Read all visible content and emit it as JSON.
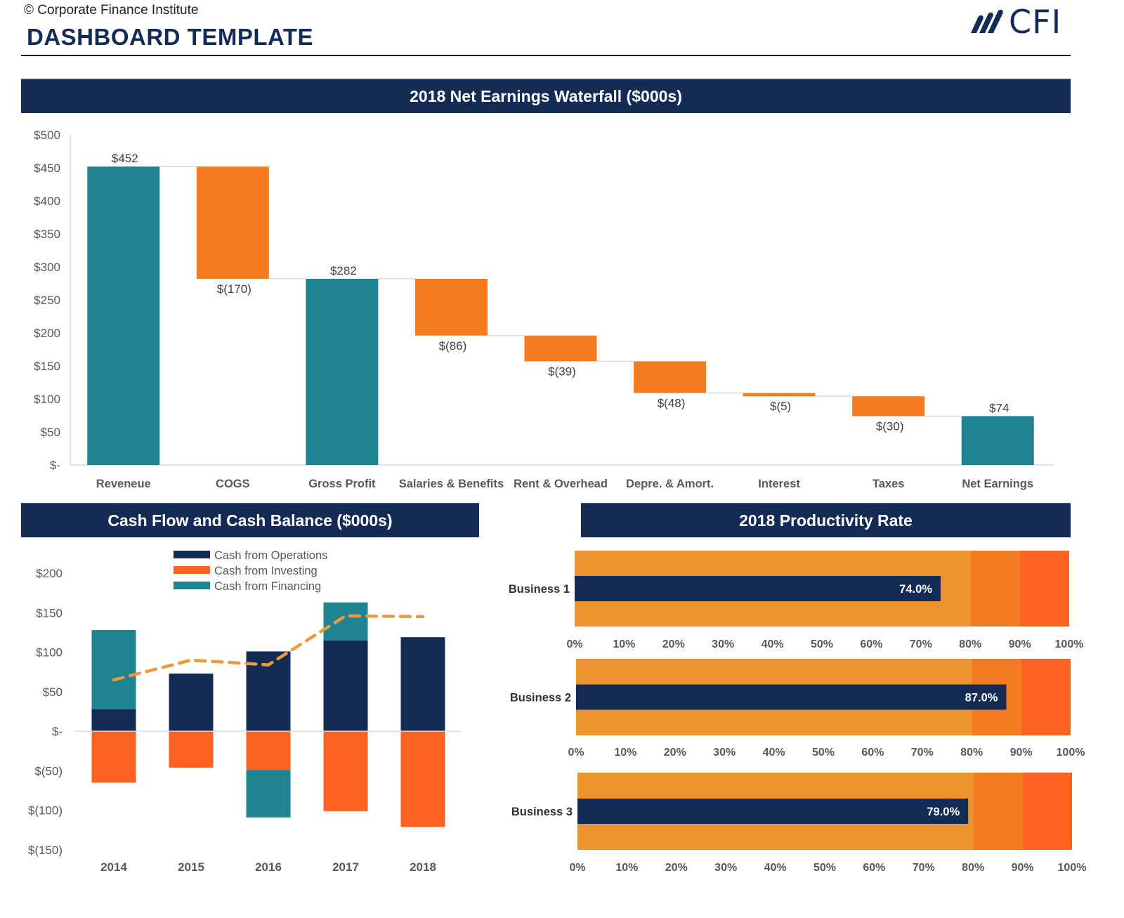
{
  "header": {
    "copyright": "© Corporate Finance Institute",
    "title": "DASHBOARD TEMPLATE",
    "logo_text": "CFI"
  },
  "colors": {
    "navy": "#142c55",
    "teal": "#1f8392",
    "orange": "#f47b20",
    "orange_red": "#fc6220",
    "band_light": "#ed942f",
    "band_mid": "#f47b20",
    "band_dark": "#fc6220",
    "line_dash": "#eb9a3c",
    "axis_text": "#595959",
    "label_text": "#404040"
  },
  "sections": {
    "waterfall_title": "2018 Net Earnings Waterfall ($000s)",
    "cash_title": "Cash Flow and Cash Balance ($000s)",
    "productivity_title": "2018 Productivity Rate"
  },
  "chart_data": [
    {
      "id": "waterfall",
      "type": "bar",
      "subtype": "waterfall",
      "title": "2018 Net Earnings Waterfall ($000s)",
      "xlabel": "",
      "ylabel": "",
      "ylim": [
        0,
        500
      ],
      "ytick_step": 50,
      "yticks": [
        "$-",
        "$50",
        "$100",
        "$150",
        "$200",
        "$250",
        "$300",
        "$350",
        "$400",
        "$450",
        "$500"
      ],
      "grid": false,
      "categories": [
        "Reveneue",
        "COGS",
        "Gross Profit",
        "Salaries & Benefits",
        "Rent & Overhead",
        "Depre. & Amort.",
        "Interest",
        "Taxes",
        "Net Earnings"
      ],
      "values": [
        452,
        -170,
        282,
        -86,
        -39,
        -48,
        -5,
        -30,
        74
      ],
      "kinds": [
        "total",
        "delta",
        "total",
        "delta",
        "delta",
        "delta",
        "delta",
        "delta",
        "total"
      ],
      "data_labels": [
        "$452",
        "$(170)",
        "$282",
        "$(86)",
        "$(39)",
        "$(48)",
        "$(5)",
        "$(30)",
        "$74"
      ]
    },
    {
      "id": "cashflow",
      "type": "bar",
      "subtype": "stacked-bar-with-line",
      "title": "Cash Flow and Cash Balance ($000s)",
      "xlabel": "",
      "ylabel": "",
      "ylim": [
        -150,
        200
      ],
      "ytick_step": 50,
      "yticks": [
        "$(150)",
        "$(100)",
        "$(50)",
        "$-",
        "$50",
        "$100",
        "$150",
        "$200"
      ],
      "grid": false,
      "legend_position": "top",
      "categories": [
        "2014",
        "2015",
        "2016",
        "2017",
        "2018"
      ],
      "series": [
        {
          "name": "Cash from Operations",
          "values": [
            28,
            73,
            101,
            115,
            119
          ]
        },
        {
          "name": "Cash from Investing",
          "values": [
            -65,
            -46,
            -49,
            -101,
            -121
          ]
        },
        {
          "name": "Cash from Financing",
          "values": [
            100,
            0,
            -60,
            48,
            0
          ]
        }
      ],
      "line": {
        "name": "Cash Balance",
        "style": "dashed",
        "values": [
          65,
          90,
          84,
          146,
          145
        ]
      }
    },
    {
      "id": "productivity",
      "type": "bar",
      "subtype": "bullet",
      "title": "2018 Productivity Rate",
      "xlim": [
        0,
        100
      ],
      "xticks": [
        "0%",
        "10%",
        "20%",
        "30%",
        "40%",
        "50%",
        "60%",
        "70%",
        "80%",
        "90%",
        "100%"
      ],
      "bands": [
        80,
        90,
        100
      ],
      "categories": [
        "Business 1",
        "Business 2",
        "Business 3"
      ],
      "values": [
        74.0,
        87.0,
        79.0
      ],
      "data_labels": [
        "74.0%",
        "87.0%",
        "79.0%"
      ]
    }
  ]
}
